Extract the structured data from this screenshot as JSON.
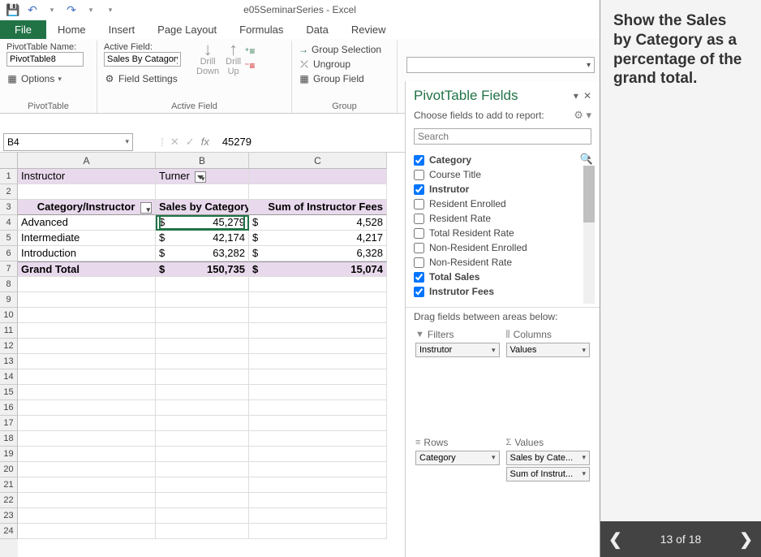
{
  "titlebar": {
    "title": "e05SeminarSeries - Excel"
  },
  "ribbon": {
    "tabs": [
      "File",
      "Home",
      "Insert",
      "Page Layout",
      "Formulas",
      "Data",
      "Review"
    ],
    "pivotTable": {
      "nameLabel": "PivotTable Name:",
      "nameValue": "PivotTable8",
      "options": "Options",
      "groupLabel": "PivotTable"
    },
    "activeField": {
      "label": "Active Field:",
      "value": "Sales By Catagory",
      "fieldSettings": "Field Settings",
      "drillDown": "Drill Down",
      "drillUp": "Drill Up",
      "groupLabel": "Active Field"
    },
    "group": {
      "selection": "Group Selection",
      "ungroup": "Ungroup",
      "field": "Group Field",
      "groupLabel": "Group"
    }
  },
  "formulaBar": {
    "nameBox": "B4",
    "fx": "45279"
  },
  "columns": [
    "A",
    "B",
    "C"
  ],
  "sheet": {
    "instructorLabel": "Instructor",
    "instructorValue": "Turner",
    "headers": {
      "A": "Category/Instructor",
      "B": "Sales by Category",
      "C": "Sum of Instructor Fees"
    },
    "rows": [
      {
        "A": "Advanced",
        "Bv": "45,279",
        "Cv": "4,528"
      },
      {
        "A": "Intermediate",
        "Bv": "42,174",
        "Cv": "4,217"
      },
      {
        "A": "Introduction",
        "Bv": "63,282",
        "Cv": "6,328"
      }
    ],
    "total": {
      "A": "Grand Total",
      "Bv": "150,735",
      "Cv": "15,074"
    },
    "dollar": "$"
  },
  "ptf": {
    "title": "PivotTable Fields",
    "subtitle": "Choose fields to add to report:",
    "searchPlaceholder": "Search",
    "fields": [
      {
        "label": "Category",
        "checked": true,
        "bold": true
      },
      {
        "label": "Course Title",
        "checked": false,
        "bold": false
      },
      {
        "label": "Instrutor",
        "checked": true,
        "bold": true
      },
      {
        "label": "Resident Enrolled",
        "checked": false,
        "bold": false
      },
      {
        "label": "Resident Rate",
        "checked": false,
        "bold": false
      },
      {
        "label": "Total Resident Rate",
        "checked": false,
        "bold": false
      },
      {
        "label": "Non-Resident Enrolled",
        "checked": false,
        "bold": false
      },
      {
        "label": "Non-Resident Rate",
        "checked": false,
        "bold": false
      },
      {
        "label": "Total Sales",
        "checked": true,
        "bold": true
      },
      {
        "label": "Instrutor Fees",
        "checked": true,
        "bold": true
      }
    ],
    "dragLabel": "Drag fields between areas below:",
    "areas": {
      "filters": {
        "label": "Filters",
        "chips": [
          "Instrutor"
        ]
      },
      "columns": {
        "label": "Columns",
        "chips": [
          "Values"
        ]
      },
      "rows": {
        "label": "Rows",
        "chips": [
          "Category"
        ]
      },
      "values": {
        "label": "Values",
        "chips": [
          "Sales by Cate...",
          "Sum of Instrut..."
        ]
      }
    }
  },
  "instruction": "Show the Sales by Category as a percentage of the grand total.",
  "nav": {
    "page": "13 of 18"
  }
}
